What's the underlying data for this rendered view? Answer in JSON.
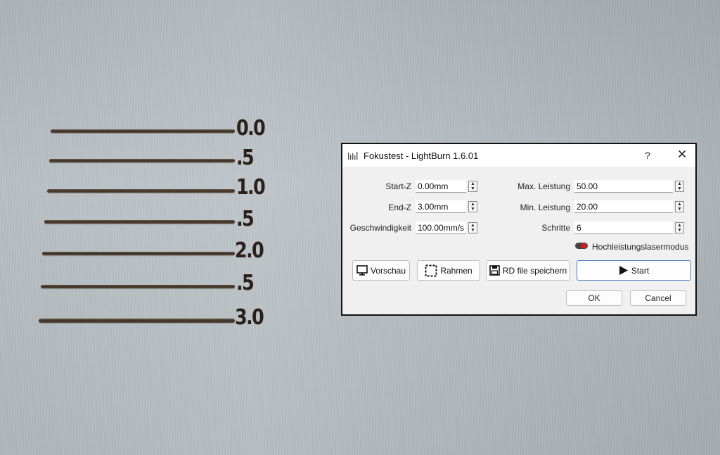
{
  "plate": {
    "marks": [
      "0.0",
      ".5",
      "1.0",
      ".5",
      "2.0",
      ".5",
      "3.0"
    ]
  },
  "dialog": {
    "title": "Fokustest - LightBurn 1.6.01",
    "help": "?",
    "close": "✕",
    "fields_left": [
      {
        "label": "Start-Z",
        "value": "0.00mm"
      },
      {
        "label": "End-Z",
        "value": "3.00mm"
      },
      {
        "label": "Geschwindigkeit",
        "value": "100.00mm/s"
      }
    ],
    "fields_right": [
      {
        "label": "Max. Leistung",
        "value": "50.00"
      },
      {
        "label": "Min. Leistung",
        "value": "20.00"
      },
      {
        "label": "Schritte",
        "value": "6"
      }
    ],
    "toggle_label": "Hochleistungslasermodus",
    "buttons": {
      "preview": "Vorschau",
      "frame": "Rahmen",
      "save_rd": "RD file speichern",
      "start": "Start",
      "ok": "OK",
      "cancel": "Cancel"
    },
    "colors": {
      "accent_border": "#4a7fc0",
      "toggle_on": "#d21d1d"
    }
  }
}
